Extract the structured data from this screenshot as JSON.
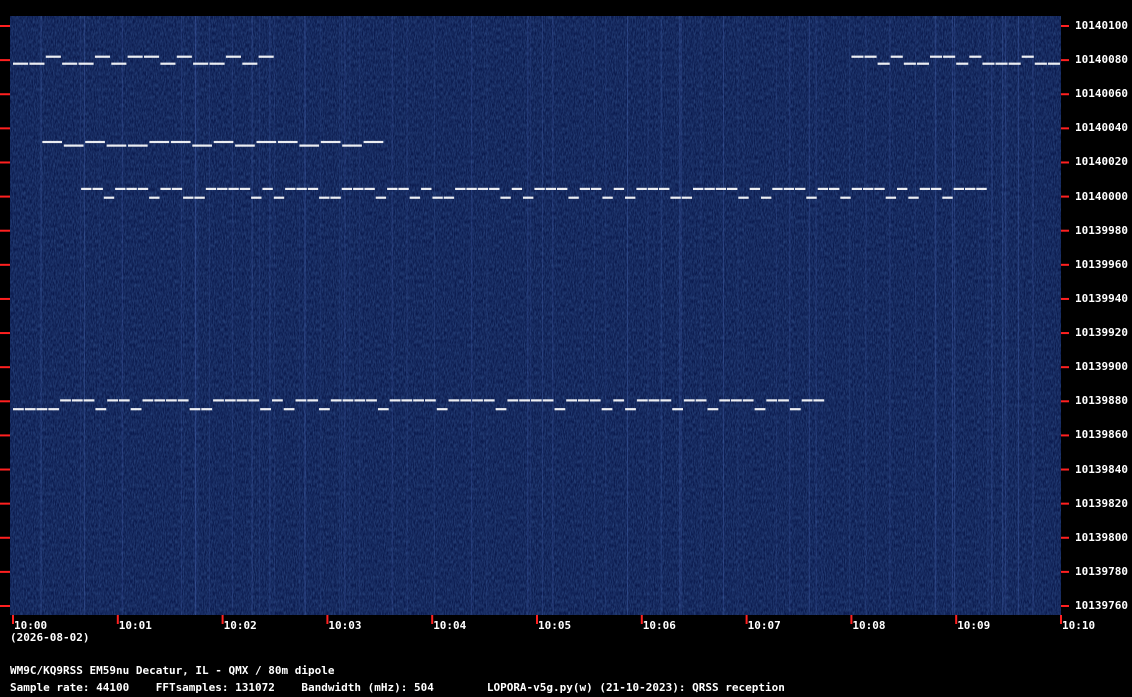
{
  "chart_data": {
    "type": "heatmap",
    "title": "",
    "xlabel": "",
    "ylabel": "",
    "x_ticks": [
      "10:00",
      "10:01",
      "10:02",
      "10:03",
      "10:04",
      "10:05",
      "10:06",
      "10:07",
      "10:08",
      "10:09",
      "10:10"
    ],
    "y_ticks": [
      "10140100",
      "10140080",
      "10140060",
      "10140040",
      "10140020",
      "10140000",
      "10139980",
      "10139960",
      "10139940",
      "10139920",
      "10139900",
      "10139880",
      "10139860",
      "10139840",
      "10139820",
      "10139800",
      "10139780",
      "10139760"
    ],
    "xlim_minutes": [
      0,
      10
    ],
    "ylim_hz": [
      10139760,
      10140100
    ],
    "date_label": "(2026-08-02)",
    "colors": {
      "background": "#0b1a4d",
      "signal": "#ffffff",
      "tick": "#ff2020",
      "grid_bg": "#000000"
    },
    "signals": [
      {
        "freq_hz": 10140002,
        "start_min": 0.65,
        "end_min": 9.3,
        "shift_hz": 5,
        "pattern": [
          1,
          1,
          0,
          1,
          1,
          1,
          0,
          1,
          1,
          0,
          0,
          1,
          1,
          1,
          1,
          0,
          1,
          0,
          1,
          1,
          1,
          0,
          0,
          1,
          1,
          1,
          0,
          1,
          1,
          0,
          1,
          0,
          0,
          1,
          1,
          1,
          1,
          0,
          1,
          0,
          1,
          1,
          1,
          0,
          1,
          1,
          0,
          1,
          0,
          1,
          1,
          1,
          0,
          0,
          1,
          1,
          1,
          1,
          0,
          1,
          0,
          1,
          1,
          1,
          0,
          1,
          1,
          0,
          1,
          1,
          1,
          0,
          1,
          0,
          1,
          1,
          0,
          1,
          1,
          1
        ]
      },
      {
        "freq_hz": 10139878,
        "start_min": 0.0,
        "end_min": 7.75,
        "shift_hz": 5,
        "pattern": [
          0,
          0,
          0,
          0,
          1,
          1,
          1,
          0,
          1,
          1,
          0,
          1,
          1,
          1,
          1,
          0,
          0,
          1,
          1,
          1,
          1,
          0,
          1,
          0,
          1,
          1,
          0,
          1,
          1,
          1,
          1,
          0,
          1,
          1,
          1,
          1,
          0,
          1,
          1,
          1,
          1,
          0,
          1,
          1,
          1,
          1,
          0,
          1,
          1,
          1,
          0,
          1,
          0,
          1,
          1,
          1,
          0,
          1,
          1,
          0,
          1,
          1,
          1,
          0,
          1,
          1,
          0,
          1,
          1
        ]
      },
      {
        "freq_hz": 10140080,
        "start_min": 0.0,
        "end_min": 2.5,
        "shift_hz": 4,
        "pattern": [
          0,
          0,
          1,
          0,
          0,
          1,
          0,
          1,
          1,
          0,
          1,
          0,
          0,
          1,
          0,
          1
        ]
      },
      {
        "freq_hz": 10140080,
        "start_min": 8.0,
        "end_min": 10.0,
        "shift_hz": 4,
        "pattern": [
          1,
          1,
          0,
          1,
          0,
          0,
          1,
          1,
          0,
          1,
          0,
          0,
          0,
          1,
          0,
          0
        ]
      },
      {
        "freq_hz": 10140031,
        "start_min": 0.28,
        "end_min": 3.55,
        "shift_hz": 2,
        "pattern": [
          1,
          0,
          1,
          0,
          0,
          1,
          1,
          0,
          1,
          0,
          1,
          1,
          0,
          1,
          0,
          1
        ]
      }
    ]
  },
  "footer": {
    "station": "WM9C/KQ9RSS EM59nu Decatur, IL - QMX / 80m dipole",
    "params": "Sample rate: 44100    FFTsamples: 131072    Bandwidth (mHz): 504        LOPORA-v5g.py(w) (21-10-2023): QRSS reception"
  }
}
